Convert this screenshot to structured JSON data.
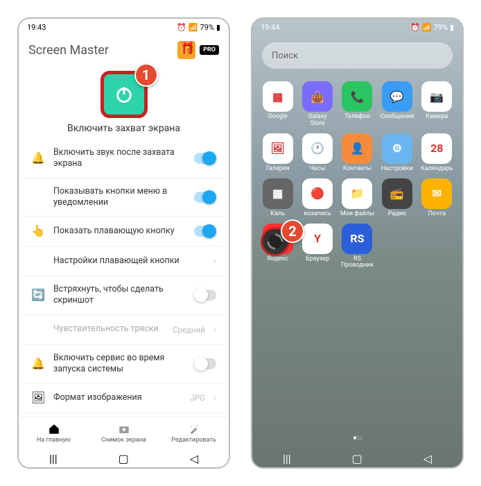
{
  "p1": {
    "time": "19:43",
    "battery": "79%",
    "title": "Screen Master",
    "pro": "PRO",
    "caption": "Включить захват экрана",
    "items": [
      {
        "icon": "bell",
        "text": "Включить звук после захвата экрана",
        "ctrl": "on"
      },
      {
        "icon": "",
        "text": "Показывать кнопки меню в уведомлении",
        "ctrl": "on"
      },
      {
        "icon": "hand",
        "text": "Показать плавающую кнопку",
        "ctrl": "on"
      },
      {
        "icon": "",
        "text": "Настройки плавающей кнопки",
        "ctrl": "chev"
      },
      {
        "icon": "shake",
        "text": "Встряхнуть, чтобы сделать скриншот",
        "ctrl": "off"
      },
      {
        "icon": "",
        "text": "Чувствительность тряски",
        "ctrl": "val",
        "val": "Средний",
        "sub": true
      },
      {
        "icon": "rocket",
        "text": "Включить сервис во время запуска системы",
        "ctrl": "off"
      },
      {
        "icon": "img",
        "text": "Формат изображения",
        "ctrl": "val",
        "val": "JPG"
      }
    ],
    "nav": [
      "На главную",
      "Снимок экрана",
      "Редактировать"
    ]
  },
  "p2": {
    "time": "19:44",
    "battery": "79%",
    "search": "Поиск",
    "apps": [
      {
        "l": "Google",
        "c": "#fff",
        "e": "▦"
      },
      {
        "l": "Galaxy Store",
        "c": "#7a6cff",
        "e": "👜"
      },
      {
        "l": "Телефон",
        "c": "#2ac562",
        "e": "📞"
      },
      {
        "l": "Сообщения",
        "c": "#3b9cf5",
        "e": "💬"
      },
      {
        "l": "Камера",
        "c": "#fff",
        "e": "📷"
      },
      {
        "l": "Галерея",
        "c": "#fff",
        "e": "🖼"
      },
      {
        "l": "Часы",
        "c": "#fff",
        "e": "🕐"
      },
      {
        "l": "Контакты",
        "c": "#f58b3b",
        "e": "👤"
      },
      {
        "l": "Настройки",
        "c": "#6ab5f0",
        "e": "⚙"
      },
      {
        "l": "Календарь",
        "c": "#fff",
        "e": "28"
      },
      {
        "l": "Каль",
        "c": "#666",
        "e": "▦"
      },
      {
        "l": "козапись",
        "c": "#fff",
        "e": "🔴"
      },
      {
        "l": "Мои файлы",
        "c": "#fff",
        "e": "📁"
      },
      {
        "l": "Радио",
        "c": "#444",
        "e": "📻"
      },
      {
        "l": "Почта",
        "c": "#ffb300",
        "e": "✉"
      },
      {
        "l": "Яндекс",
        "c": "#f33",
        "e": "Я"
      },
      {
        "l": "Браузер",
        "c": "#fff",
        "e": "Y"
      },
      {
        "l": "RS Проводник",
        "c": "#2b5fd9",
        "e": "RS"
      }
    ]
  },
  "markers": {
    "m1": "1",
    "m2": "2"
  }
}
